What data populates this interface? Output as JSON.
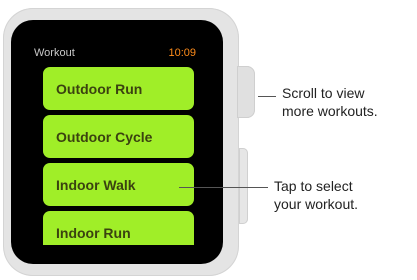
{
  "header": {
    "app_title": "Workout",
    "time": "10:09"
  },
  "workouts": [
    {
      "label": "Outdoor Run"
    },
    {
      "label": "Outdoor Cycle"
    },
    {
      "label": "Indoor Walk"
    },
    {
      "label": "Indoor Run"
    }
  ],
  "callouts": {
    "crown_line1": "Scroll to view",
    "crown_line2": "more workouts.",
    "tap_line1": "Tap to select",
    "tap_line2": "your workout."
  },
  "colors": {
    "tile": "#a0ee28",
    "tile_text": "#3a4210",
    "clock": "#ff8c1a"
  }
}
